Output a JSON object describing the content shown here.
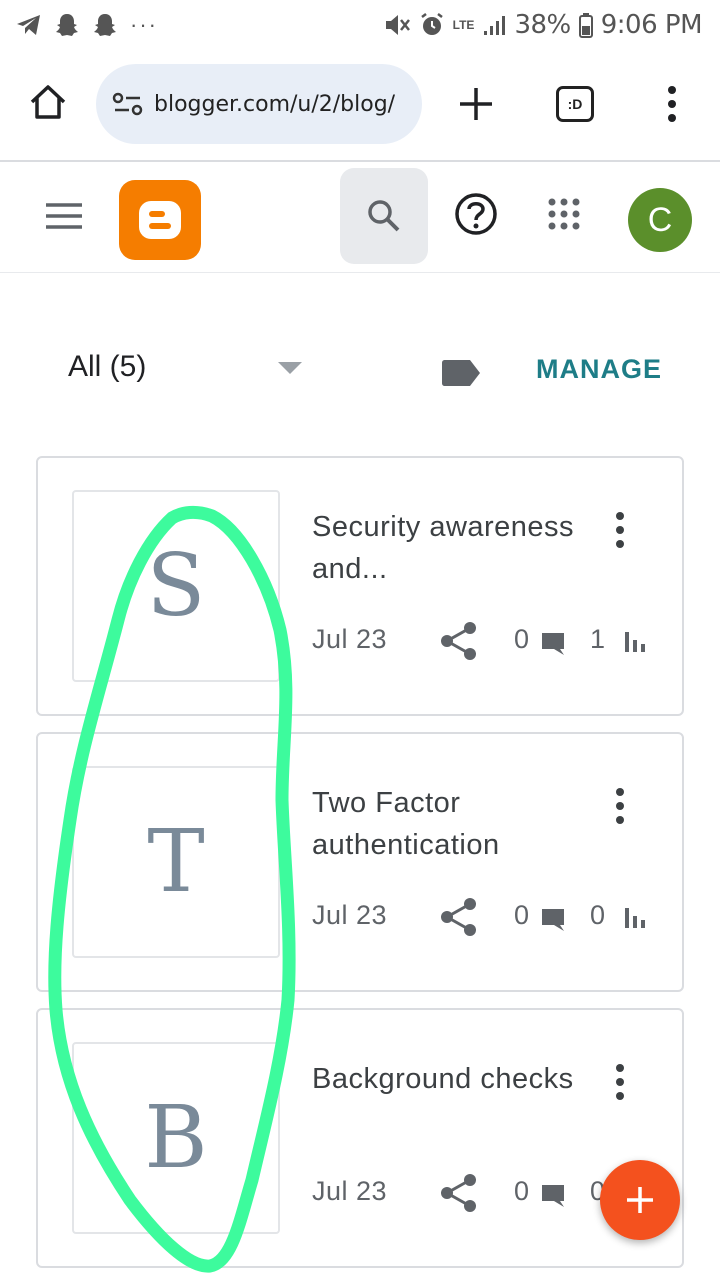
{
  "status_bar": {
    "battery": "38%",
    "time": "9:06 PM",
    "network": "LTE",
    "more": "···"
  },
  "browser": {
    "url": "blogger.com/u/2/blog/",
    "tabs_label": ":D"
  },
  "header": {
    "avatar_initial": "C"
  },
  "filter": {
    "label": "All (5)",
    "manage_label": "MANAGE"
  },
  "posts": [
    {
      "letter": "S",
      "title": "Security awareness and...",
      "date": "Jul 23",
      "comments": "0",
      "views": "1"
    },
    {
      "letter": "T",
      "title": "Two Factor authentication",
      "date": "Jul 23",
      "comments": "0",
      "views": "0"
    },
    {
      "letter": "B",
      "title": "Background checks",
      "date": "Jul 23",
      "comments": "0",
      "views": "0"
    }
  ],
  "colors": {
    "accent": "#1e7d87",
    "logo": "#f57d00",
    "fab": "#f4511e",
    "avatar": "#5b8f2b",
    "annotation": "#3dfb9d"
  }
}
